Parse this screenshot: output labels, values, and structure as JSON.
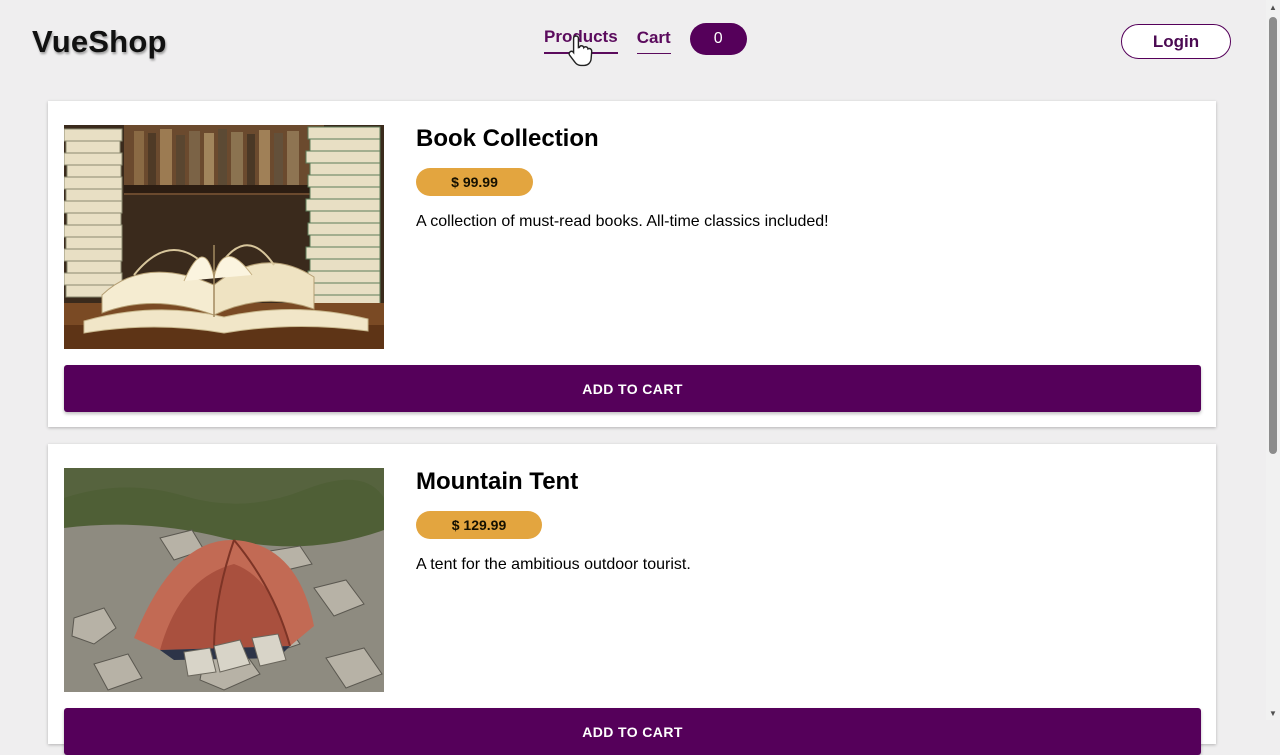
{
  "header": {
    "brand": "VueShop",
    "nav": {
      "products_label": "Products",
      "cart_label": "Cart",
      "cart_count": "0"
    },
    "login_label": "Login"
  },
  "products": [
    {
      "title": "Book Collection",
      "price": "$ 99.99",
      "description": "A collection of must-read books. All-time classics included!",
      "add_label": "ADD TO CART",
      "image": "books-photo"
    },
    {
      "title": "Mountain Tent",
      "price": "$ 129.99",
      "description": "A tent for the ambitious outdoor tourist.",
      "add_label": "ADD TO CART",
      "image": "tent-photo"
    }
  ],
  "colors": {
    "accent": "#55005a",
    "price_badge": "#e3a53f",
    "background": "#efeeef"
  }
}
